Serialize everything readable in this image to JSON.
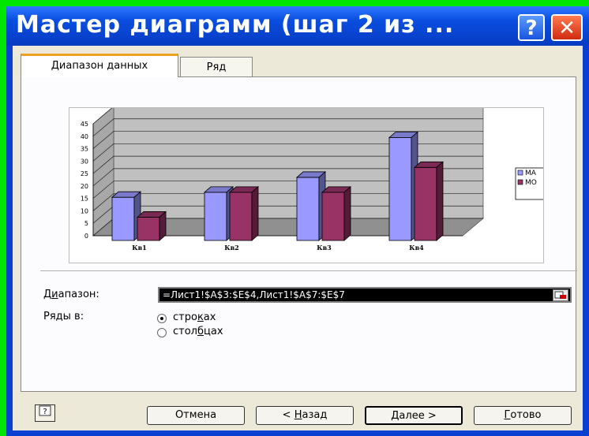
{
  "window": {
    "title": "Мастер диаграмм (шаг 2 из ...",
    "help_glyph": "?",
    "close_glyph": "✕"
  },
  "tabs": [
    {
      "label": "Диапазон данных",
      "active": true
    },
    {
      "label": "Ряд",
      "active": false
    }
  ],
  "chart_data": {
    "type": "bar",
    "categories": [
      "Кв1",
      "Кв2",
      "Кв3",
      "Кв4"
    ],
    "series": [
      {
        "name": "МА",
        "values": [
          18,
          20,
          26,
          42
        ],
        "color": "#9999ff"
      },
      {
        "name": "МО",
        "values": [
          10,
          20,
          20,
          30
        ],
        "color": "#993366"
      }
    ],
    "ylim": [
      0,
      45
    ],
    "yticks": [
      "0",
      "5",
      "10",
      "15",
      "20",
      "25",
      "30",
      "35",
      "40",
      "45"
    ],
    "grid": true,
    "legend": "right"
  },
  "form": {
    "range_label_pre": "Д",
    "range_label_u": "и",
    "range_label_post": "апазон:",
    "range_value": "=Лист1!$A$3:$E$4,Лист1!$A$7:$E$7",
    "series_in_label": "Ряды в:",
    "radio_rows_pre": "стро",
    "radio_rows_u": "к",
    "radio_rows_post": "ах",
    "radio_cols_pre": "стол",
    "radio_cols_u": "б",
    "radio_cols_post": "цах",
    "selected": "rows"
  },
  "buttons": {
    "cancel": "Отмена",
    "back_pre": "< ",
    "back_u": "Н",
    "back_post": "азад",
    "next_u": "Д",
    "next_post": "алее >",
    "finish_u": "Г",
    "finish_post": "отово"
  },
  "colors": {
    "title_bar": "#0a4ee0",
    "frame": "#00e600",
    "series1": "#9999ff",
    "series2": "#993366"
  }
}
